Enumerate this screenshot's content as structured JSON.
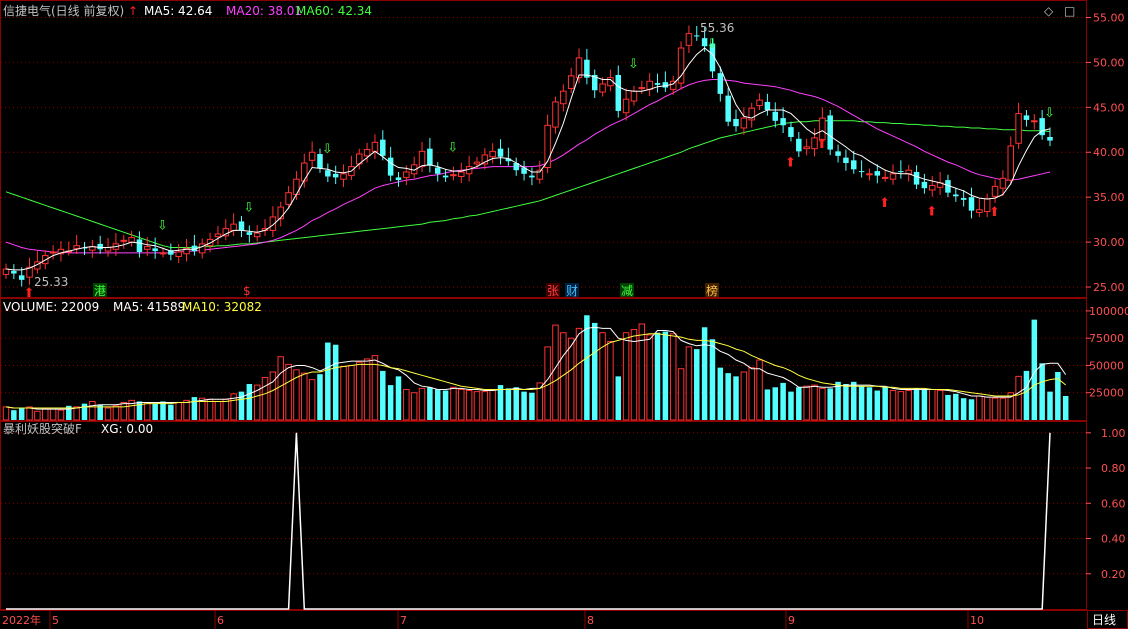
{
  "header": {
    "title": "信捷电气(日线 前复权)",
    "arrow_color": "#ff2020",
    "ma": [
      {
        "label": "MA5: 42.64",
        "color": "#ffffff"
      },
      {
        "label": "MA20: 38.01",
        "color": "#ff40ff"
      },
      {
        "label": "MA60: 42.34",
        "color": "#40ff40"
      }
    ]
  },
  "volume_header": {
    "labels": [
      {
        "label": "VOLUME: 22009",
        "color": "#ffffff"
      },
      {
        "label": "MA5: 41589",
        "color": "#ffffff"
      },
      {
        "label": "MA10: 32082",
        "color": "#ffff40"
      }
    ]
  },
  "indicator_header": {
    "labels": [
      {
        "label": "暴利妖股突破F",
        "color": "#c0c0c0"
      },
      {
        "label": "XG: 0.00",
        "color": "#ffffff"
      }
    ]
  },
  "price_axis": [
    "55.00",
    "50.00",
    "45.00",
    "40.00",
    "35.00",
    "30.00",
    "25.00"
  ],
  "volume_axis": [
    "100000",
    "75000",
    "50000",
    "25000"
  ],
  "indicator_axis": [
    "1.00",
    "0.80",
    "0.60",
    "0.40",
    "0.20"
  ],
  "x_axis": [
    "2022年",
    "5",
    "6",
    "7",
    "8",
    "9",
    "10"
  ],
  "period_button": "日线",
  "annotations": {
    "high": "55.36",
    "low": "25.33"
  },
  "tags": [
    {
      "text": "港",
      "color": "#40ff40",
      "bg": "#004000"
    },
    {
      "text": "$",
      "color": "#ff3030",
      "bg": ""
    },
    {
      "text": "张",
      "color": "#ff4040",
      "bg": "#400000"
    },
    {
      "text": "财",
      "color": "#40c0ff",
      "bg": "#002040"
    },
    {
      "text": "减",
      "color": "#40ff40",
      "bg": "#004000"
    },
    {
      "text": "榜",
      "color": "#ffc040",
      "bg": "#402000"
    }
  ],
  "colors": {
    "up": "#ff3232",
    "down": "#54ffff",
    "ma5": "#ffffff",
    "ma20": "#ff40ff",
    "ma60": "#40ff40",
    "grid": "#8b0000",
    "axis_text": "#ff5050"
  },
  "chart_data": {
    "type": "candlestick",
    "price_range": [
      24,
      56.5
    ],
    "closes": [
      27.0,
      26.5,
      25.8,
      27.2,
      27.8,
      28.5,
      28.9,
      29.2,
      29.0,
      29.6,
      29.3,
      29.5,
      29.2,
      29.4,
      29.8,
      30.2,
      30.5,
      28.9,
      29.5,
      29.0,
      28.8,
      28.6,
      28.9,
      29.3,
      29.0,
      29.8,
      30.3,
      30.9,
      31.5,
      32.0,
      31.3,
      30.8,
      31.0,
      31.5,
      32.8,
      33.9,
      35.5,
      37.0,
      38.8,
      40.0,
      38.2,
      37.3,
      37.2,
      37.6,
      38.4,
      39.8,
      40.3,
      41.1,
      39.6,
      37.4,
      36.9,
      37.8,
      38.6,
      40.1,
      38.5,
      37.6,
      37.2,
      37.5,
      37.8,
      38.4,
      38.9,
      39.7,
      40.1,
      39.5,
      39.0,
      38.0,
      37.6,
      37.2,
      38.0,
      43.0,
      45.6,
      46.8,
      48.5,
      50.5,
      48.3,
      46.9,
      47.6,
      48.3,
      44.6,
      45.9,
      46.8,
      47.2,
      47.9,
      47.5,
      47.2,
      47.9,
      51.6,
      53.2,
      52.9,
      51.8,
      49.0,
      46.5,
      43.4,
      42.9,
      43.8,
      44.9,
      45.8,
      44.7,
      43.5,
      43.0,
      41.7,
      40.1,
      40.6,
      41.6,
      43.8,
      40.3,
      39.6,
      38.8,
      38.1,
      37.8,
      37.6,
      37.4,
      37.2,
      37.6,
      37.8,
      38.0,
      36.4,
      36.0,
      36.3,
      36.6,
      35.5,
      35.1,
      34.7,
      33.5,
      33.6,
      34.8,
      36.2,
      37.1,
      40.7,
      44.3,
      43.6,
      43.5,
      41.9,
      41.3
    ],
    "ma5": [
      27.0,
      26.9,
      26.9,
      27.1,
      27.5,
      28.0,
      28.5,
      28.8,
      29.0,
      29.2,
      29.4,
      29.5,
      29.4,
      29.4,
      29.5,
      29.7,
      30.0,
      29.9,
      29.7,
      29.6,
      29.3,
      29.0,
      29.1,
      29.2,
      29.2,
      29.5,
      29.9,
      30.4,
      30.9,
      31.3,
      31.3,
      31.2,
      31.1,
      31.3,
      31.9,
      32.7,
      33.8,
      35.3,
      36.9,
      38.3,
      38.2,
      38.1,
      37.8,
      37.7,
      37.9,
      38.7,
      39.4,
      40.1,
      39.5,
      38.8,
      38.3,
      38.2,
      38.0,
      38.5,
      38.6,
      38.4,
      38.1,
      37.9,
      37.9,
      38.1,
      38.4,
      38.9,
      39.3,
      39.4,
      39.3,
      38.8,
      38.3,
      37.8,
      37.8,
      39.0,
      41.0,
      43.2,
      46.0,
      48.6,
      48.6,
      48.4,
      48.1,
      48.1,
      47.3,
      46.9,
      46.8,
      46.8,
      47.0,
      47.3,
      47.4,
      47.6,
      48.5,
      49.8,
      50.9,
      51.6,
      50.9,
      49.4,
      47.3,
      45.3,
      44.0,
      43.8,
      44.3,
      44.7,
      44.7,
      44.7,
      44.3,
      43.5,
      42.6,
      42.0,
      42.4,
      41.8,
      41.2,
      40.6,
      39.9,
      39.6,
      39.0,
      38.5,
      38.0,
      37.7,
      37.6,
      37.6,
      37.3,
      37.0,
      36.8,
      36.6,
      36.3,
      36.0,
      35.7,
      35.2,
      34.9,
      34.8,
      34.9,
      35.3,
      36.5,
      38.5,
      40.2,
      41.7,
      42.4,
      42.6
    ],
    "ma20": [
      30.0,
      29.7,
      29.4,
      29.2,
      29.1,
      29.0,
      28.9,
      28.9,
      28.8,
      28.8,
      28.8,
      28.8,
      28.8,
      28.8,
      28.8,
      28.8,
      28.8,
      28.8,
      28.8,
      28.8,
      28.8,
      28.8,
      28.9,
      29.0,
      29.0,
      29.1,
      29.2,
      29.3,
      29.4,
      29.5,
      29.6,
      29.7,
      29.8,
      30.0,
      30.2,
      30.5,
      30.9,
      31.3,
      31.8,
      32.4,
      32.8,
      33.3,
      33.7,
      34.2,
      34.6,
      35.0,
      35.5,
      36.0,
      36.3,
      36.5,
      36.7,
      36.9,
      37.0,
      37.2,
      37.4,
      37.5,
      37.7,
      37.9,
      38.0,
      38.1,
      38.2,
      38.3,
      38.4,
      38.4,
      38.4,
      38.4,
      38.4,
      38.4,
      38.5,
      38.8,
      39.2,
      39.7,
      40.3,
      40.9,
      41.4,
      42.0,
      42.5,
      43.0,
      43.4,
      43.8,
      44.3,
      44.8,
      45.3,
      45.7,
      46.2,
      46.6,
      47.1,
      47.5,
      47.8,
      48.0,
      48.1,
      48.1,
      48.0,
      47.9,
      47.7,
      47.6,
      47.5,
      47.4,
      47.3,
      47.1,
      46.9,
      46.6,
      46.4,
      46.2,
      45.9,
      45.5,
      45.1,
      44.6,
      44.1,
      43.6,
      43.1,
      42.6,
      42.2,
      41.8,
      41.4,
      41.0,
      40.6,
      40.1,
      39.7,
      39.3,
      38.9,
      38.6,
      38.2,
      37.8,
      37.5,
      37.3,
      37.1,
      36.9,
      36.9,
      37.0,
      37.2,
      37.4,
      37.6,
      37.8
    ],
    "ma60": [
      35.6,
      35.3,
      35.0,
      34.7,
      34.4,
      34.1,
      33.8,
      33.5,
      33.2,
      32.9,
      32.6,
      32.3,
      32.0,
      31.7,
      31.4,
      31.1,
      30.8,
      30.5,
      30.2,
      29.9,
      29.6,
      29.4,
      29.4,
      29.4,
      29.4,
      29.5,
      29.5,
      29.6,
      29.6,
      29.7,
      29.8,
      29.8,
      29.9,
      30.0,
      30.1,
      30.2,
      30.3,
      30.4,
      30.5,
      30.6,
      30.7,
      30.8,
      30.9,
      31.0,
      31.1,
      31.2,
      31.3,
      31.4,
      31.5,
      31.6,
      31.7,
      31.8,
      31.9,
      32.0,
      32.2,
      32.3,
      32.4,
      32.6,
      32.7,
      32.9,
      33.0,
      33.2,
      33.4,
      33.6,
      33.8,
      34.0,
      34.2,
      34.4,
      34.6,
      34.9,
      35.2,
      35.5,
      35.8,
      36.1,
      36.4,
      36.7,
      37.0,
      37.3,
      37.6,
      37.9,
      38.2,
      38.5,
      38.8,
      39.1,
      39.4,
      39.7,
      40.0,
      40.4,
      40.7,
      41.0,
      41.3,
      41.6,
      41.8,
      42.0,
      42.2,
      42.4,
      42.6,
      42.8,
      43.0,
      43.2,
      43.3,
      43.4,
      43.4,
      43.5,
      43.5,
      43.5,
      43.5,
      43.5,
      43.5,
      43.4,
      43.4,
      43.3,
      43.3,
      43.2,
      43.2,
      43.1,
      43.1,
      43.0,
      43.0,
      42.9,
      42.9,
      42.8,
      42.8,
      42.7,
      42.7,
      42.6,
      42.6,
      42.5,
      42.5,
      42.5,
      42.4,
      42.4,
      42.4,
      42.3
    ],
    "volume_range": [
      0,
      110000
    ],
    "volume": [
      12000,
      9000,
      11000,
      12000,
      8000,
      10000,
      11000,
      9000,
      13000,
      12000,
      15000,
      17000,
      14000,
      11000,
      13000,
      16000,
      18000,
      17000,
      16000,
      15000,
      17000,
      14000,
      16000,
      18000,
      21000,
      20000,
      19000,
      17000,
      19000,
      24000,
      26000,
      33000,
      32000,
      39000,
      44000,
      58000,
      51000,
      46000,
      43000,
      37000,
      42000,
      71000,
      69000,
      49000,
      50000,
      53000,
      56000,
      59000,
      45000,
      32000,
      40000,
      28000,
      25000,
      29000,
      30000,
      28000,
      27000,
      30000,
      28000,
      27000,
      26000,
      26000,
      28000,
      32000,
      29000,
      30000,
      26000,
      25000,
      34000,
      67000,
      87000,
      80000,
      75000,
      84000,
      96000,
      89000,
      80000,
      72000,
      40000,
      80000,
      83000,
      88000,
      78000,
      80000,
      81000,
      79000,
      47000,
      67000,
      65000,
      85000,
      74000,
      48000,
      43000,
      40000,
      44000,
      48000,
      55000,
      28000,
      30000,
      34000,
      26000,
      30000,
      31000,
      32000,
      29000,
      29000,
      35000,
      33000,
      35000,
      31000,
      30000,
      27000,
      30000,
      27000,
      26000,
      27000,
      29000,
      28000,
      28000,
      27000,
      23000,
      24000,
      20000,
      19000,
      22000,
      21000,
      20000,
      20000,
      25000,
      40000,
      45000,
      92000,
      52000,
      26000,
      44000,
      22009
    ],
    "volume_ma5": [
      12000,
      11000,
      11000,
      11000,
      10000,
      10000,
      10000,
      10000,
      10000,
      11000,
      12000,
      13000,
      14000,
      14000,
      14000,
      15000,
      15000,
      16000,
      16000,
      16000,
      16000,
      16000,
      16000,
      16000,
      17000,
      18000,
      19000,
      19000,
      19000,
      20000,
      21000,
      24000,
      27000,
      31000,
      35000,
      43000,
      48000,
      50000,
      50000,
      48000,
      45000,
      48000,
      52000,
      53000,
      54000,
      54000,
      54000,
      55000,
      52000,
      48000,
      46000,
      41000,
      34000,
      31000,
      30000,
      28000,
      28000,
      29000,
      29000,
      28000,
      28000,
      27000,
      27000,
      28000,
      28000,
      29000,
      28000,
      29000,
      29000,
      37000,
      48000,
      59000,
      68000,
      79000,
      84000,
      85000,
      84000,
      84000,
      75000,
      73000,
      72000,
      73000,
      74000,
      82000,
      82000,
      81000,
      73000,
      70000,
      68000,
      69000,
      68000,
      63000,
      60000,
      55000,
      52000,
      47000,
      47000,
      43000,
      41000,
      39000,
      35000,
      30000,
      30000,
      31000,
      30000,
      30000,
      31000,
      32000,
      32000,
      32000,
      32000,
      31000,
      31000,
      29000,
      28000,
      28000,
      28000,
      28000,
      28000,
      28000,
      27000,
      26000,
      24000,
      22000,
      22000,
      21000,
      21000,
      21000,
      21000,
      25000,
      30000,
      44000,
      51000,
      52000,
      52000,
      41589
    ],
    "volume_ma10": [
      12000,
      11000,
      11000,
      11000,
      11000,
      11000,
      11000,
      11000,
      11000,
      11000,
      12000,
      12000,
      12000,
      12000,
      12000,
      12000,
      13000,
      14000,
      15000,
      15000,
      15000,
      15000,
      16000,
      16000,
      17000,
      17000,
      17000,
      17000,
      17000,
      18000,
      19000,
      20000,
      22000,
      24000,
      27000,
      31000,
      35000,
      39000,
      42000,
      44000,
      44000,
      46000,
      48000,
      49000,
      50000,
      51000,
      51000,
      51000,
      50000,
      48000,
      47000,
      45000,
      43000,
      41000,
      39000,
      37000,
      35000,
      33000,
      31000,
      30000,
      29000,
      28000,
      28000,
      28000,
      28000,
      28000,
      28000,
      28000,
      29000,
      32000,
      36000,
      41000,
      46000,
      52000,
      57000,
      62000,
      67000,
      71000,
      73000,
      75000,
      77000,
      78000,
      79000,
      79000,
      78000,
      77000,
      76000,
      74000,
      73000,
      73000,
      72000,
      70000,
      68000,
      65000,
      63000,
      59000,
      56000,
      53000,
      50000,
      48000,
      45000,
      41000,
      38000,
      36000,
      34000,
      33000,
      32000,
      31000,
      31000,
      31000,
      31000,
      31000,
      30000,
      30000,
      29000,
      29000,
      29000,
      29000,
      28000,
      28000,
      28000,
      27000,
      26000,
      25000,
      24000,
      23000,
      22000,
      22000,
      22000,
      23000,
      26000,
      32000,
      35000,
      37000,
      38000,
      32082
    ],
    "indicator_range": [
      0,
      1.05
    ],
    "xg": [
      0,
      0,
      0,
      0,
      0,
      0,
      0,
      0,
      0,
      0,
      0,
      0,
      0,
      0,
      0,
      0,
      0,
      0,
      0,
      0,
      0,
      0,
      0,
      0,
      0,
      0,
      0,
      0,
      0,
      0,
      0,
      0,
      0,
      0,
      0,
      0,
      0,
      1,
      0,
      0,
      0,
      0,
      0,
      0,
      0,
      0,
      0,
      0,
      0,
      0,
      0,
      0,
      0,
      0,
      0,
      0,
      0,
      0,
      0,
      0,
      0,
      0,
      0,
      0,
      0,
      0,
      0,
      0,
      0,
      0,
      0,
      0,
      0,
      0,
      0,
      0,
      0,
      0,
      0,
      0,
      0,
      0,
      0,
      0,
      0,
      0,
      0,
      0,
      0,
      0,
      0,
      0,
      0,
      0,
      0,
      0,
      0,
      0,
      0,
      0,
      0,
      0,
      0,
      0,
      0,
      0,
      0,
      0,
      0,
      0,
      0,
      0,
      0,
      0,
      0,
      0,
      0,
      0,
      0,
      0,
      0,
      0,
      0,
      0,
      0,
      0,
      0,
      0,
      0,
      0,
      0,
      0,
      0,
      1,
      0,
      0,
      0,
      0,
      0,
      0,
      0,
      0,
      0,
      0,
      0,
      0,
      0,
      0,
      0,
      0,
      0,
      0,
      0,
      0,
      0,
      0,
      0,
      0,
      0,
      0,
      0,
      0,
      0,
      0,
      0,
      0,
      0,
      0,
      0
    ]
  }
}
